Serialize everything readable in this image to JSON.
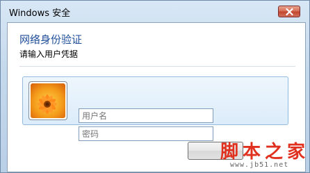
{
  "window": {
    "title": "Windows 安全",
    "close_icon": "close-icon"
  },
  "dialog": {
    "heading": "网络身份验证",
    "subheading": "请输入用户凭据"
  },
  "credentials": {
    "avatar_icon": "flower-avatar-icon",
    "username_placeholder": "用户名",
    "password_placeholder": "密码"
  },
  "watermark": {
    "text": "脚本之家",
    "url": "www.jb51.net"
  }
}
